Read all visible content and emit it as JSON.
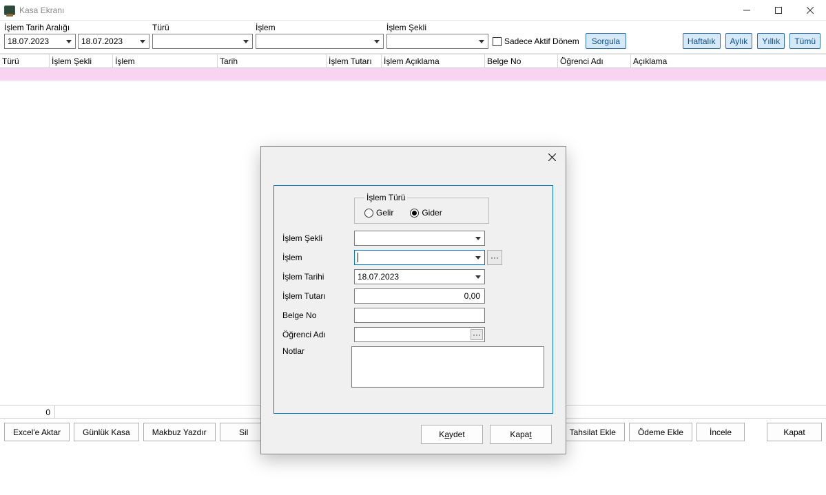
{
  "titlebar": {
    "title": "Kasa Ekranı"
  },
  "filter": {
    "date_range_label": "İşlem Tarih Aralığı",
    "date_from": "18.07.2023",
    "date_to": "18.07.2023",
    "type_label": "Türü",
    "islem_label": "İşlem",
    "islem_sekli_label": "İşlem Şekli",
    "only_active_label": "Sadece Aktif Dönem",
    "query_btn": "Sorgula",
    "quick": {
      "weekly": "Haftalık",
      "monthly": "Aylık",
      "yearly": "Yıllık",
      "all": "Tümü"
    }
  },
  "grid": {
    "headers": {
      "turu": "Türü",
      "islem_sekli": "İşlem Şekli",
      "islem": "İşlem",
      "tarih": "Tarih",
      "islem_tutari": "İşlem Tutarı",
      "islem_aciklama": "İşlem Açıklama",
      "belge_no": "Belge No",
      "ogrenci_adi": "Öğrenci Adı",
      "aciklama": "Açıklama"
    },
    "status": {
      "count": "0"
    }
  },
  "bottom": {
    "excel": "Excel'e Aktar",
    "gunluk": "Günlük Kasa",
    "makbuz": "Makbuz Yazdır",
    "sil": "Sil",
    "tahsilat": "Tahsilat Ekle",
    "odeme": "Ödeme Ekle",
    "incele": "İncele",
    "kapat": "Kapat"
  },
  "modal": {
    "group_legend": "İşlem Türü",
    "radio_gelir": "Gelir",
    "radio_gider": "Gider",
    "islem_sekli": "İşlem Şekli",
    "islem": "İşlem",
    "islem_tarihi": "İşlem Tarihi",
    "islem_tarihi_value": "18.07.2023",
    "islem_tutari": "İşlem Tutarı",
    "islem_tutari_value": "0,00",
    "belge_no": "Belge No",
    "ogrenci_adi": "Öğrenci Adı",
    "notlar": "Notlar",
    "more": "···",
    "kaydet_pre": "K",
    "kaydet_key": "a",
    "kaydet_post": "ydet",
    "kapat_pre": "Kapa",
    "kapat_key": "t",
    "kapat_post": ""
  }
}
